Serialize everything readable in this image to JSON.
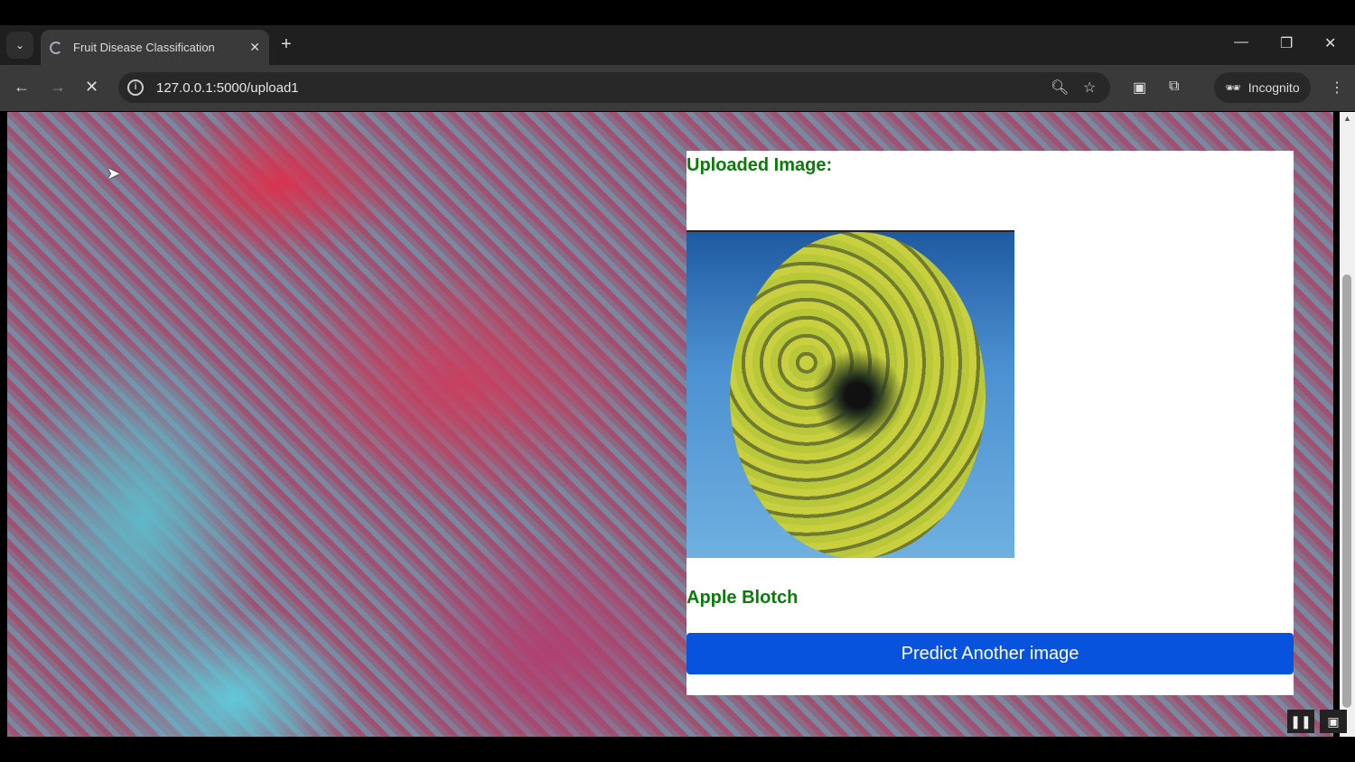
{
  "browser": {
    "tab_title": "Fruit Disease Classification",
    "url": "127.0.0.1:5000/upload1",
    "profile_label": "Incognito"
  },
  "page": {
    "uploaded_heading": "Uploaded Image:",
    "prediction": "Apple Blotch",
    "predict_another_label": "Predict Another image"
  },
  "colors": {
    "heading": "#0a7a0a",
    "button": "#0753dd"
  }
}
